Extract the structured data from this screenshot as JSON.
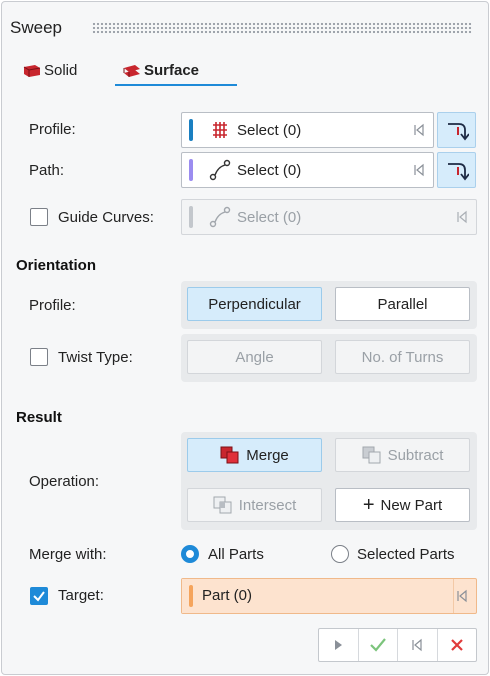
{
  "panel": {
    "title": "Sweep"
  },
  "tabs": [
    {
      "label": "Solid",
      "icon": "solid-sweep-icon"
    },
    {
      "label": "Surface",
      "icon": "surface-sweep-icon",
      "selected": true
    }
  ],
  "inputs": {
    "profile": {
      "label": "Profile:",
      "value": "Select (0)",
      "color": "#1a7fc1",
      "icon": "profile-grid-icon"
    },
    "path": {
      "label": "Path:",
      "value": "Select (0)",
      "color": "#9b8cf0",
      "icon": "path-curve-icon"
    },
    "guide_curves": {
      "label": "Guide Curves:",
      "value": "Select (0)",
      "checked": false,
      "icon": "curve-icon"
    }
  },
  "orientation": {
    "title": "Orientation",
    "profile_label": "Profile:",
    "options": [
      "Perpendicular",
      "Parallel"
    ],
    "selected": "Perpendicular",
    "twist_label": "Twist Type:",
    "twist_checked": false,
    "twist_options": [
      "Angle",
      "No. of Turns"
    ]
  },
  "result": {
    "title": "Result",
    "operation_label": "Operation:",
    "operations": [
      "Merge",
      "Subtract",
      "Intersect",
      "New Part"
    ],
    "selected_operation": "Merge",
    "new_part_prefix": "+",
    "merge_with_label": "Merge with:",
    "merge_options": [
      "All Parts",
      "Selected Parts"
    ],
    "merge_selected": "All Parts",
    "target_label": "Target:",
    "target_checked": true,
    "target_value": "Part (0)"
  },
  "colors": {
    "accent": "#1e8ad8",
    "cancel": "#e03a3a",
    "ok": "#7cc47c"
  }
}
